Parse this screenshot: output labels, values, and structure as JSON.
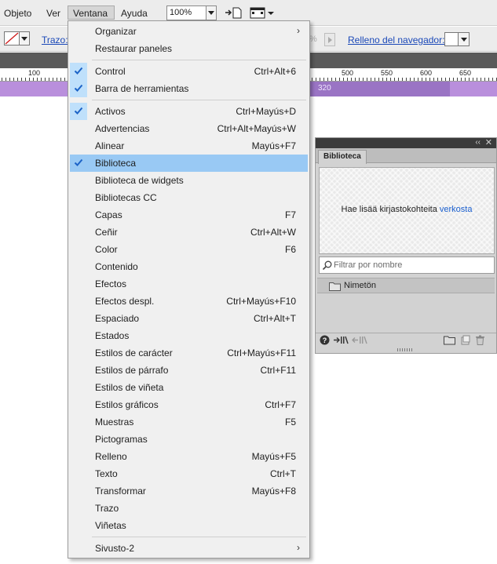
{
  "menubar": {
    "items": [
      {
        "label": "Objeto"
      },
      {
        "label": "Ver"
      },
      {
        "label": "Ventana"
      },
      {
        "label": "Ayuda"
      }
    ],
    "zoom_value": "100%"
  },
  "controlbar": {
    "stroke_label": "Trazo:",
    "percent_text": "%",
    "browser_fill_label": "Relleno del navegador:"
  },
  "ruler": {
    "labels": [
      "100",
      "500",
      "550",
      "600",
      "650"
    ],
    "bar_label": "320"
  },
  "colors": {
    "menu_highlight": "#99c9f4",
    "check_blue": "#1c63c7",
    "purple_bar": "#b98fdc",
    "link_blue": "#1a5fcf"
  },
  "window_menu": {
    "groups": [
      [
        {
          "label": "Organizar",
          "shortcut": "",
          "submenu": true,
          "checked": false
        },
        {
          "label": "Restaurar paneles",
          "shortcut": "",
          "submenu": false,
          "checked": false
        }
      ],
      [
        {
          "label": "Control",
          "shortcut": "Ctrl+Alt+6",
          "submenu": false,
          "checked": true
        },
        {
          "label": "Barra de herramientas",
          "shortcut": "",
          "submenu": false,
          "checked": true
        }
      ],
      [
        {
          "label": "Activos",
          "shortcut": "Ctrl+Mayús+D",
          "submenu": false,
          "checked": true
        },
        {
          "label": "Advertencias",
          "shortcut": "Ctrl+Alt+Mayús+W",
          "submenu": false,
          "checked": false
        },
        {
          "label": "Alinear",
          "shortcut": "Mayús+F7",
          "submenu": false,
          "checked": false
        },
        {
          "label": "Biblioteca",
          "shortcut": "",
          "submenu": false,
          "checked": true,
          "highlighted": true
        },
        {
          "label": "Biblioteca de widgets",
          "shortcut": "",
          "submenu": false,
          "checked": false
        },
        {
          "label": "Bibliotecas CC",
          "shortcut": "",
          "submenu": false,
          "checked": false
        },
        {
          "label": "Capas",
          "shortcut": "F7",
          "submenu": false,
          "checked": false
        },
        {
          "label": "Ceñir",
          "shortcut": "Ctrl+Alt+W",
          "submenu": false,
          "checked": false
        },
        {
          "label": "Color",
          "shortcut": "F6",
          "submenu": false,
          "checked": false
        },
        {
          "label": "Contenido",
          "shortcut": "",
          "submenu": false,
          "checked": false
        },
        {
          "label": "Efectos",
          "shortcut": "",
          "submenu": false,
          "checked": false
        },
        {
          "label": "Efectos despl.",
          "shortcut": "Ctrl+Mayús+F10",
          "submenu": false,
          "checked": false
        },
        {
          "label": "Espaciado",
          "shortcut": "Ctrl+Alt+T",
          "submenu": false,
          "checked": false
        },
        {
          "label": "Estados",
          "shortcut": "",
          "submenu": false,
          "checked": false
        },
        {
          "label": "Estilos de carácter",
          "shortcut": "Ctrl+Mayús+F11",
          "submenu": false,
          "checked": false
        },
        {
          "label": "Estilos de párrafo",
          "shortcut": "Ctrl+F11",
          "submenu": false,
          "checked": false
        },
        {
          "label": "Estilos de viñeta",
          "shortcut": "",
          "submenu": false,
          "checked": false
        },
        {
          "label": "Estilos gráficos",
          "shortcut": "Ctrl+F7",
          "submenu": false,
          "checked": false
        },
        {
          "label": "Muestras",
          "shortcut": "F5",
          "submenu": false,
          "checked": false
        },
        {
          "label": "Pictogramas",
          "shortcut": "",
          "submenu": false,
          "checked": false
        },
        {
          "label": "Relleno",
          "shortcut": "Mayús+F5",
          "submenu": false,
          "checked": false
        },
        {
          "label": "Texto",
          "shortcut": "Ctrl+T",
          "submenu": false,
          "checked": false
        },
        {
          "label": "Transformar",
          "shortcut": "Mayús+F8",
          "submenu": false,
          "checked": false
        },
        {
          "label": "Trazo",
          "shortcut": "",
          "submenu": false,
          "checked": false
        },
        {
          "label": "Viñetas",
          "shortcut": "",
          "submenu": false,
          "checked": false
        }
      ],
      [
        {
          "label": "Sivusto-2",
          "shortcut": "",
          "submenu": true,
          "checked": false
        }
      ]
    ]
  },
  "library_panel": {
    "tab_label": "Biblioteca",
    "promo_text": "Hae lisää kirjastokohteita",
    "promo_link": "verkosta",
    "filter_placeholder": "Filtrar por nombre",
    "folder_name": "Nimetön"
  }
}
